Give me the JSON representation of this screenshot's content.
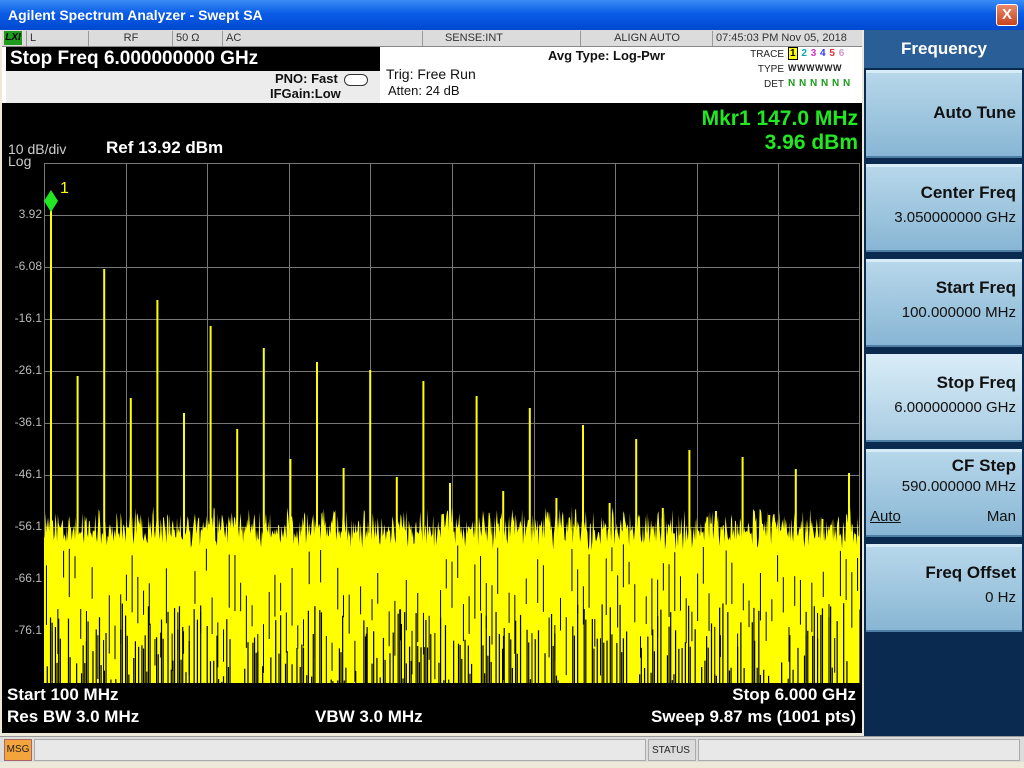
{
  "window": {
    "title": "Agilent Spectrum Analyzer - Swept SA",
    "close_glyph": "X"
  },
  "status_row": {
    "lxi": "LXI",
    "cells": [
      "L",
      "RF",
      "50 Ω",
      "AC",
      "SENSE:INT",
      "ALIGN AUTO",
      "07:45:03 PM Nov 05, 2018"
    ]
  },
  "header": {
    "stop_freq": "Stop Freq 6.000000000 GHz",
    "pno": "PNO: Fast",
    "ifgain": "IFGain:Low",
    "trig": "Trig: Free Run",
    "atten": "Atten: 24 dB",
    "avg_type": "Avg Type: Log-Pwr",
    "trace_label": "TRACE",
    "trace_nums": [
      "1",
      "2",
      "3",
      "4",
      "5",
      "6"
    ],
    "type_label": "TYPE",
    "type_value": "WWWWWW",
    "det_label": "DET",
    "det_value": "N N N N N N"
  },
  "screen": {
    "marker_freq": "Mkr1 147.0 MHz",
    "marker_amp": "3.96 dBm",
    "scale": "10 dB/div",
    "scale_type": "Log",
    "ref_level": "Ref 13.92 dBm",
    "marker_label": "1",
    "y_labels": [
      "3.92",
      "-6.08",
      "-16.1",
      "-26.1",
      "-36.1",
      "-46.1",
      "-56.1",
      "-66.1",
      "-76.1"
    ],
    "start": "Start 100 MHz",
    "stop": "Stop 6.000 GHz",
    "res_bw": "Res BW 3.0 MHz",
    "vbw": "VBW 3.0 MHz",
    "sweep": "Sweep  9.87 ms (1001 pts)",
    "colors": {
      "trace": "#ffff00",
      "marker": "#22e822",
      "grid": "#777777"
    }
  },
  "softkeys": {
    "title": "Frequency",
    "auto_tune": "Auto Tune",
    "center_freq": {
      "label": "Center Freq",
      "value": "3.050000000 GHz"
    },
    "start_freq": {
      "label": "Start Freq",
      "value": "100.000000 MHz"
    },
    "stop_freq": {
      "label": "Stop Freq",
      "value": "6.000000000 GHz"
    },
    "cf_step": {
      "label": "CF Step",
      "value": "590.000000 MHz",
      "auto": "Auto",
      "man": "Man"
    },
    "freq_offset": {
      "label": "Freq Offset",
      "value": "0 Hz"
    }
  },
  "bottom": {
    "msg": "MSG",
    "status": "STATUS"
  }
}
